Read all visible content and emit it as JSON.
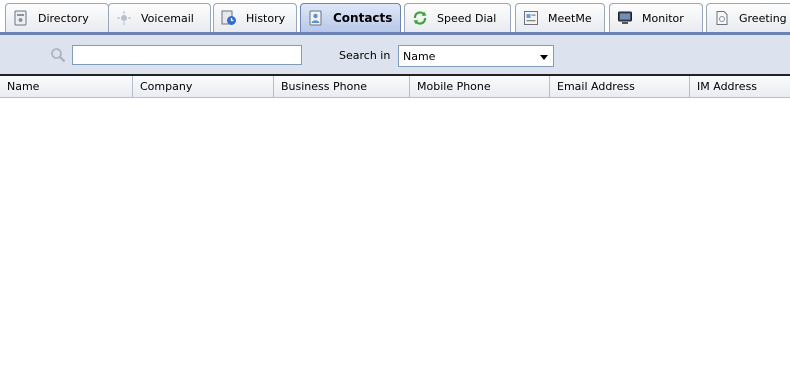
{
  "tabs": [
    {
      "label": "Directory",
      "icon": "directory-icon"
    },
    {
      "label": "Voicemail",
      "icon": "voicemail-icon"
    },
    {
      "label": "History",
      "icon": "history-icon"
    },
    {
      "label": "Contacts",
      "icon": "contacts-icon",
      "active": true
    },
    {
      "label": "Speed Dial",
      "icon": "speed-dial-icon"
    },
    {
      "label": "MeetMe",
      "icon": "meetme-icon"
    },
    {
      "label": "Monitor",
      "icon": "monitor-icon"
    },
    {
      "label": "Greeting",
      "icon": "greeting-icon"
    }
  ],
  "search": {
    "icon": "magnifier-icon",
    "value": "",
    "search_in_label": "Search in",
    "search_in_selected": "Name"
  },
  "table": {
    "columns": [
      "Name",
      "Company",
      "Business Phone",
      "Mobile Phone",
      "Email Address",
      "IM Address"
    ],
    "rows": []
  },
  "colors": {
    "accent": "#6d83b3",
    "toolbar_bg": "#dde3ee",
    "active_tab": "#c3d1ec"
  }
}
